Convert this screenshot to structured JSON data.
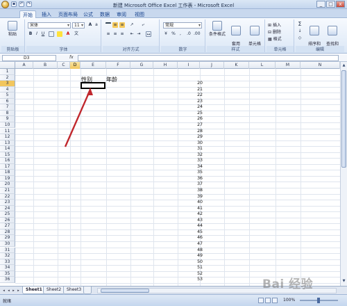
{
  "window": {
    "title": "新建 Microsoft Office Excel 工作表 - Microsoft Excel",
    "controls": [
      "_",
      "□",
      "x"
    ]
  },
  "tabs": [
    "开始",
    "插入",
    "页面布局",
    "公式",
    "数据",
    "审阅",
    "视图"
  ],
  "ribbon": {
    "paste_label": "粘贴",
    "font_name": "宋体",
    "font_size": "11",
    "number_format": "常规",
    "groups": [
      "剪贴板",
      "字体",
      "对齐方式",
      "数字",
      "样式",
      "单元格",
      "编辑"
    ],
    "style_buttons": [
      "条件格式",
      "套用\n表格格式",
      "单元格\n样式"
    ],
    "cells_buttons": [
      "插入",
      "删除",
      "格式"
    ],
    "edit_buttons": [
      "排序和\n筛选",
      "查找和\n选择"
    ],
    "bold": "B",
    "italic": "I",
    "underline": "U",
    "percent": "%",
    "comma": ","
  },
  "formula_bar": {
    "name_box": "D3",
    "fx": "fx",
    "content": ""
  },
  "columns": [
    "A",
    "B",
    "C",
    "D",
    "E",
    "F",
    "G",
    "H",
    "I",
    "J",
    "K",
    "L",
    "M",
    "N"
  ],
  "active_column": "D",
  "rows": [
    "1",
    "2",
    "3",
    "4",
    "5",
    "6",
    "7",
    "8",
    "9",
    "10",
    "11",
    "12",
    "13",
    "14",
    "15",
    "16",
    "17",
    "18",
    "19",
    "20",
    "21",
    "22",
    "23",
    "24",
    "25",
    "26",
    "27",
    "28",
    "29",
    "30",
    "31",
    "32",
    "33",
    "34",
    "35",
    "36"
  ],
  "active_row": "3",
  "cells": {
    "D2": "性别",
    "E2": "年龄"
  },
  "column_I_values": [
    20,
    21,
    22,
    23,
    24,
    25,
    26,
    27,
    28,
    29,
    30,
    31,
    32,
    33,
    34,
    35,
    36,
    37,
    38,
    39,
    40,
    41,
    42,
    43,
    44,
    45,
    46,
    47,
    48,
    49,
    50,
    51,
    52,
    53
  ],
  "sheets": [
    "Sheet1",
    "Sheet2",
    "Sheet3"
  ],
  "active_sheet": "Sheet1",
  "status": {
    "ready": "就绪",
    "zoom": "100%"
  },
  "watermark": "Bai 经验",
  "colors": {
    "annotation_arrow": "#c0272d",
    "selection_border": "#000000",
    "active_header": "#f2c65e"
  }
}
